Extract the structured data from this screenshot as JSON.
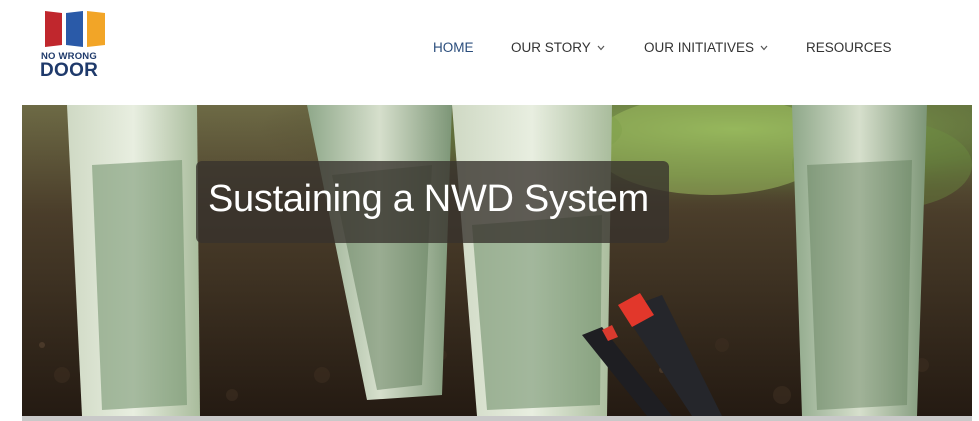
{
  "logo": {
    "line1": "NO WRONG",
    "line2": "DOOR",
    "colors": [
      "#c0272d",
      "#2a5aa8",
      "#f2a527"
    ]
  },
  "nav": {
    "items": [
      {
        "label": "HOME",
        "active": true,
        "dropdown": false
      },
      {
        "label": "OUR STORY",
        "active": false,
        "dropdown": true
      },
      {
        "label": "OUR INITIATIVES",
        "active": false,
        "dropdown": true
      },
      {
        "label": "RESOURCES",
        "active": false,
        "dropdown": false
      }
    ],
    "caret_icon": "chevron-down-icon",
    "caret_glyph": "⌄"
  },
  "hero": {
    "title": "Sustaining a NWD System",
    "image_subject": "rolled dollar bills planted in soil"
  },
  "colors": {
    "nav_active": "#2a4d7c",
    "nav_text": "#333333",
    "title_box": "#37322d"
  }
}
